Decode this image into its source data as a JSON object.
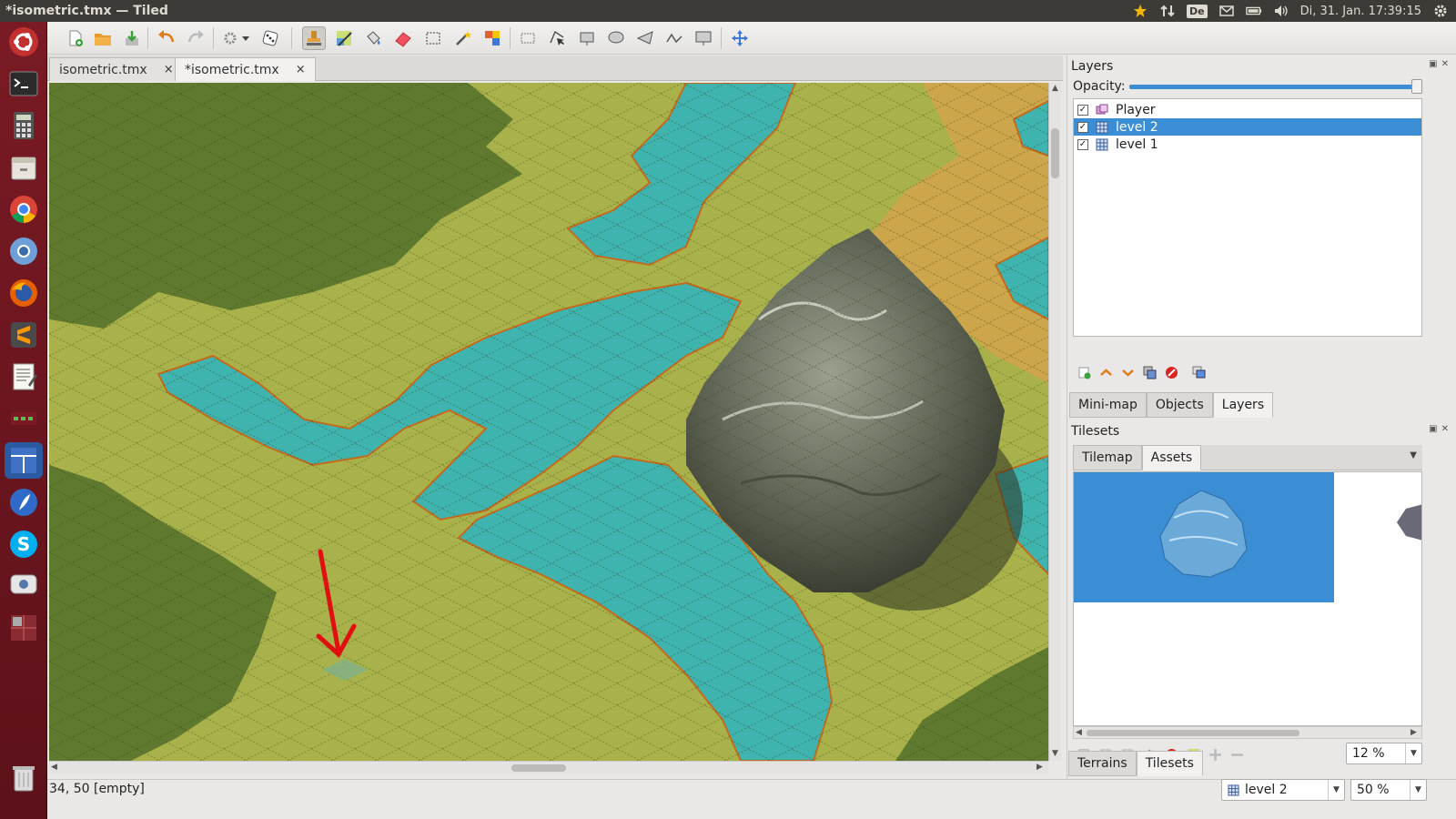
{
  "window": {
    "title": "*isometric.tmx — Tiled"
  },
  "system_tray": {
    "keyboard_layout": "De",
    "clock": "Di, 31. Jan. 17:39:15"
  },
  "launcher": {
    "items": [
      "ubuntu-dash",
      "terminal",
      "calculator",
      "files",
      "chrome",
      "chromium",
      "firefox",
      "sublime-text",
      "text-editor",
      "calc-app",
      "tiled",
      "text-tool",
      "skype",
      "messaging",
      "workspaces"
    ],
    "trash": "trash"
  },
  "document_tabs": [
    {
      "label": "isometric.tmx",
      "close": "×"
    },
    {
      "label": "*isometric.tmx",
      "close": "×"
    }
  ],
  "layers_panel": {
    "title": "Layers",
    "opacity_label": "Opacity:",
    "opacity_value": 1.0,
    "layers": [
      {
        "name": "Player",
        "visible": true,
        "type": "object"
      },
      {
        "name": "level 2",
        "visible": true,
        "type": "tile",
        "selected": true
      },
      {
        "name": "level 1",
        "visible": true,
        "type": "tile"
      }
    ],
    "tabs": [
      "Mini-map",
      "Objects",
      "Layers"
    ],
    "active_tab": "Layers"
  },
  "tilesets_panel": {
    "title": "Tilesets",
    "tabs": [
      "Tilemap",
      "Assets"
    ],
    "active_tab": "Assets",
    "zoom": "12 %",
    "bottom_tabs": [
      "Terrains",
      "Tilesets"
    ],
    "active_bottom_tab": "Tilesets"
  },
  "status_bar": {
    "coords": "34, 50 [empty]",
    "current_layer": "level 2",
    "zoom": "50 %"
  },
  "colors": {
    "launcher": "#6b1520",
    "selection": "#3b8ed4",
    "grass": "#a9b24a",
    "dark_grass": "#5f7a2e",
    "water": "#3fb3ad",
    "annotation_arrow": "#e01010"
  }
}
